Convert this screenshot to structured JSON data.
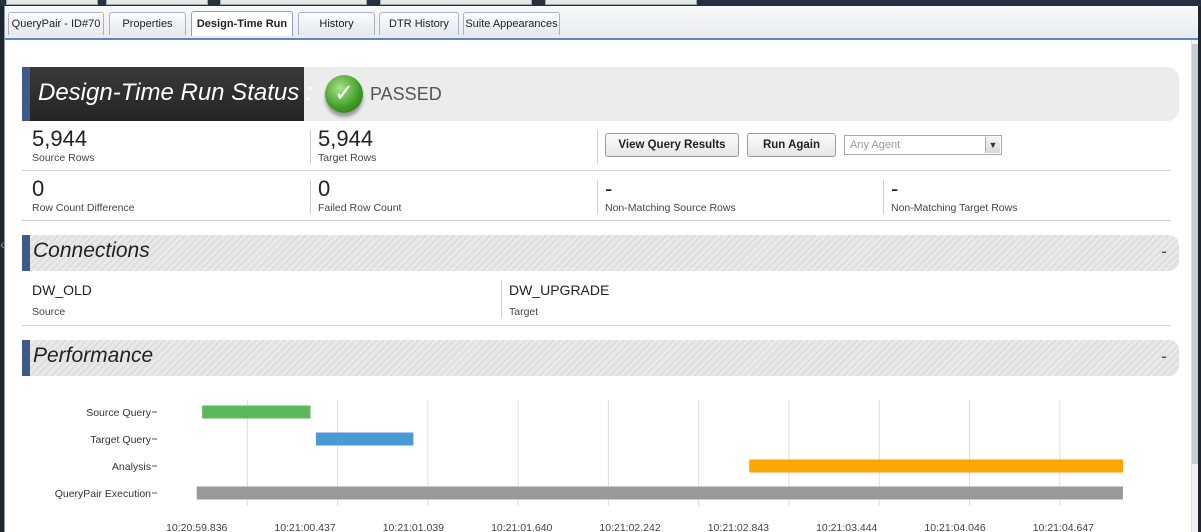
{
  "tabs": [
    {
      "label": "QueryPair - ID#70",
      "active": false
    },
    {
      "label": "Properties",
      "active": false
    },
    {
      "label": "Design-Time Run",
      "active": true
    },
    {
      "label": "History",
      "active": false
    },
    {
      "label": "DTR History",
      "active": false
    },
    {
      "label": "Suite Appearances",
      "active": false
    }
  ],
  "status": {
    "title": "Design-Time Run Status :",
    "result": "PASSED",
    "result_icon": "check-circle-icon",
    "result_color": "#3d9a24"
  },
  "metrics": {
    "source_rows": {
      "value": "5,944",
      "label": "Source Rows"
    },
    "target_rows": {
      "value": "5,944",
      "label": "Target Rows"
    },
    "row_count_difference": {
      "value": "0",
      "label": "Row Count Difference"
    },
    "failed_row_count": {
      "value": "0",
      "label": "Failed Row Count"
    },
    "non_matching_source": {
      "value": "-",
      "label": "Non-Matching Source Rows"
    },
    "non_matching_target": {
      "value": "-",
      "label": "Non-Matching Target Rows"
    }
  },
  "actions": {
    "view_results_label": "View Query Results",
    "run_again_label": "Run Again",
    "agent_placeholder": "Any Agent"
  },
  "connections": {
    "title": "Connections",
    "collapse_symbol": "-",
    "source": {
      "value": "DW_OLD",
      "label": "Source"
    },
    "target": {
      "value": "DW_UPGRADE",
      "label": "Target"
    }
  },
  "performance": {
    "title": "Performance",
    "collapse_symbol": "-"
  },
  "chart_data": {
    "type": "gantt",
    "title": "",
    "x_ticks": [
      "10:20:59.836",
      "10:21:00.437",
      "10:21:01.039",
      "10:21:01.640",
      "10:21:02.242",
      "10:21:02.843",
      "10:21:03.444",
      "10:21:04.046",
      "10:21:04.647"
    ],
    "x_range_seconds": [
      -0.25,
      5.15
    ],
    "categories": [
      "Source Query",
      "Target Query",
      "Analysis",
      "QueryPair Execution"
    ],
    "series": [
      {
        "category": "Source Query",
        "start": 0.0,
        "end": 0.6,
        "color": "#5cb85c"
      },
      {
        "category": "Target Query",
        "start": 0.63,
        "end": 1.17,
        "color": "#4a9ad4"
      },
      {
        "category": "Analysis",
        "start": 3.03,
        "end": 5.1,
        "color": "#ffa500"
      },
      {
        "category": "QueryPair Execution",
        "start": -0.03,
        "end": 5.1,
        "color": "#999999"
      }
    ],
    "grid": true
  }
}
